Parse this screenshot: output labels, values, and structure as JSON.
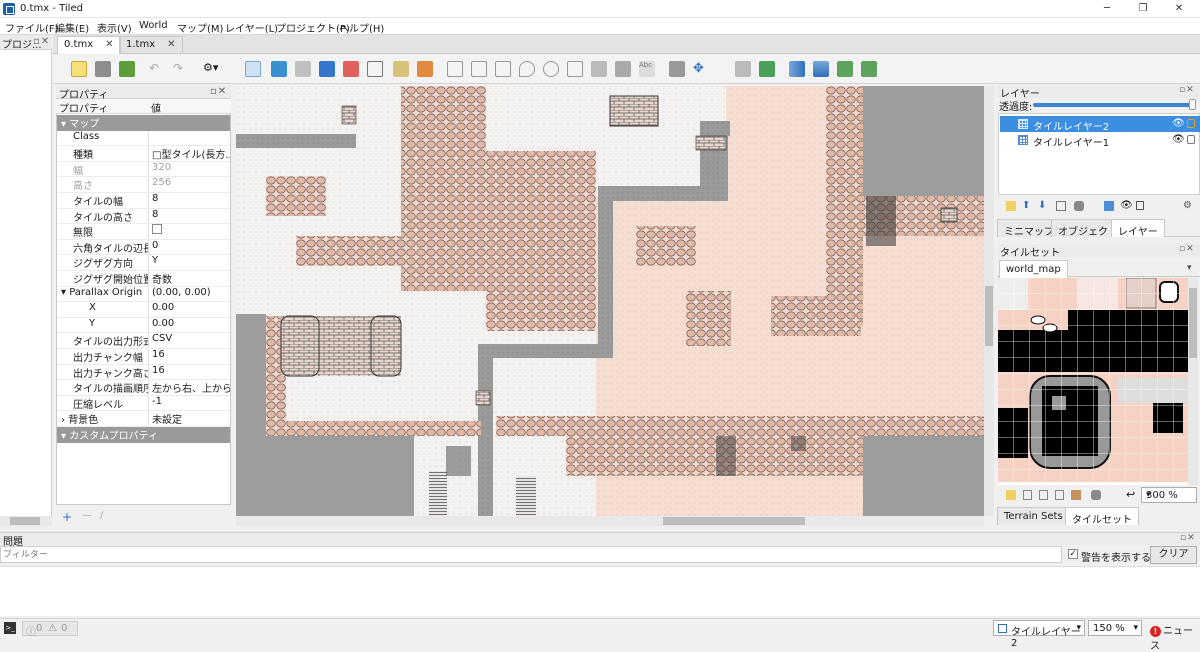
{
  "window": {
    "title": "0.tmx - Tiled"
  },
  "menu": [
    "ファイル(F)",
    "編集(E)",
    "表示(V)",
    "World",
    "マップ(M)",
    "レイヤー(L)",
    "プロジェクト(P)",
    "ヘルプ(H)"
  ],
  "left_dock": {
    "title": "プロジ..."
  },
  "tabs": [
    {
      "label": "0.tmx",
      "active": true
    },
    {
      "label": "1.tmx",
      "active": false
    }
  ],
  "properties": {
    "title": "プロパティ",
    "col_name": "プロパティ",
    "col_value": "値",
    "rows": [
      {
        "key": "マップ",
        "value": "",
        "type": "group"
      },
      {
        "key": "Class",
        "value": ""
      },
      {
        "key": "種類",
        "value": "□型タイル(長方..."
      },
      {
        "key": "幅",
        "value": "320",
        "type": "dim"
      },
      {
        "key": "高さ",
        "value": "256",
        "type": "dim"
      },
      {
        "key": "タイルの幅",
        "value": "8"
      },
      {
        "key": "タイルの高さ",
        "value": "8"
      },
      {
        "key": "無限",
        "value": "",
        "type": "check"
      },
      {
        "key": "六角タイルの辺長",
        "value": "0"
      },
      {
        "key": "ジグザグ方向",
        "value": "Y"
      },
      {
        "key": "ジグザグ開始位置",
        "value": "奇数"
      },
      {
        "key": "Parallax Origin",
        "value": "(0.00, 0.00)",
        "type": "expand"
      },
      {
        "key": "X",
        "value": "0.00",
        "type": "indent"
      },
      {
        "key": "Y",
        "value": "0.00",
        "type": "indent"
      },
      {
        "key": "タイルの出力形式",
        "value": "CSV"
      },
      {
        "key": "出力チャンク幅",
        "value": "16"
      },
      {
        "key": "出力チャンク高さ",
        "value": "16"
      },
      {
        "key": "タイルの描画順序",
        "value": "左から右、上から下"
      },
      {
        "key": "圧縮レベル",
        "value": "-1"
      },
      {
        "key": "背景色",
        "value": "未設定",
        "type": "expand"
      },
      {
        "key": "カスタムプロパティ",
        "value": "",
        "type": "group"
      }
    ]
  },
  "layers": {
    "title": "レイヤー",
    "opacity_label": "透過度:",
    "opacity": 1.0,
    "items": [
      {
        "name": "タイルレイヤー2",
        "selected": true
      },
      {
        "name": "タイルレイヤー1",
        "selected": false
      }
    ]
  },
  "right_tabs_top": [
    {
      "label": "ミニマップ",
      "active": false
    },
    {
      "label": "オブジェクト",
      "active": false
    },
    {
      "label": "レイヤー",
      "active": true
    }
  ],
  "tilesets": {
    "title": "タイルセット",
    "active_tab": "world_map",
    "zoom": "300 %"
  },
  "right_tabs_bottom": [
    {
      "label": "Terrain Sets",
      "active": false
    },
    {
      "label": "タイルセット",
      "active": true
    }
  ],
  "issues": {
    "title": "問題",
    "filter_placeholder": "フィルター",
    "show_warnings_label": "警告を表示する",
    "show_warnings": true,
    "clear_label": "クリア"
  },
  "status": {
    "errors": "0",
    "warnings": "0",
    "current_layer": "タイルレイヤー2",
    "zoom": "150 %",
    "news_label": "ニュース"
  }
}
